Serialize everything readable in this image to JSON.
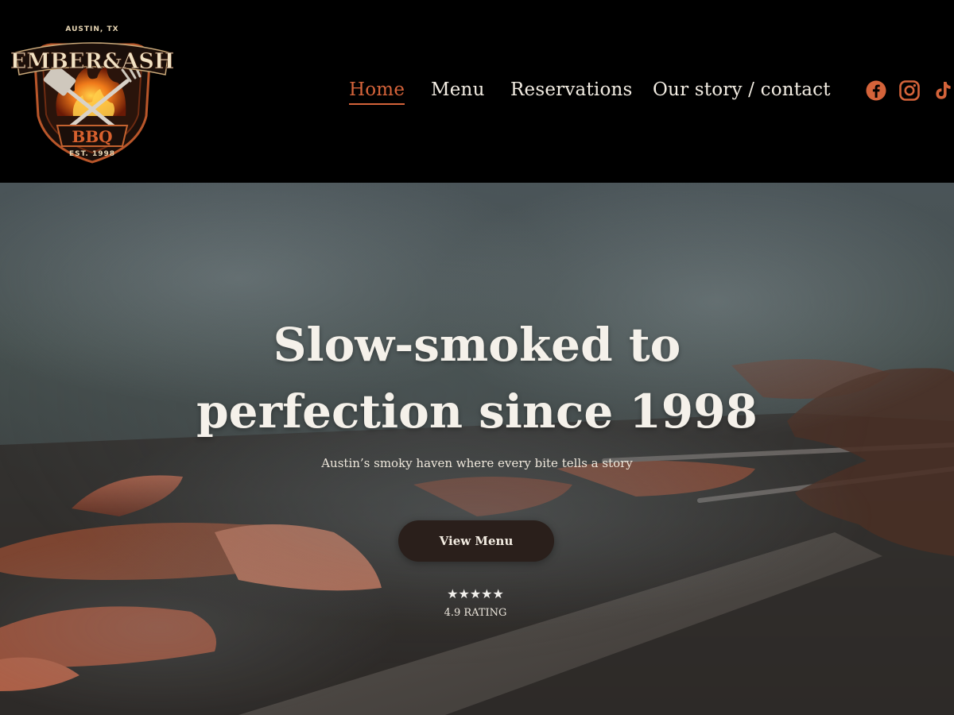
{
  "logo": {
    "top_text": "AUSTIN, TX",
    "brand": "EMBER&ASH",
    "badge": "BBQ",
    "bottom_text": "EST. 1998"
  },
  "nav": {
    "items": [
      {
        "label": "Home",
        "active": true
      },
      {
        "label": "Menu",
        "active": false
      },
      {
        "label": "Reservations",
        "active": false
      },
      {
        "label": "Our story / contact",
        "active": false
      }
    ],
    "active_color": "#d4633a"
  },
  "social": {
    "icons": [
      "facebook-icon",
      "instagram-icon",
      "tiktok-icon"
    ],
    "color": "#d4633a"
  },
  "hero": {
    "title_line1": "Slow-smoked to",
    "title_line2": "perfection since 1998",
    "subtitle": "Austin’s smoky haven where every bite tells a story",
    "cta_label": "View Menu",
    "stars": "★★★★★",
    "rating_text": "4.9 RATING"
  }
}
